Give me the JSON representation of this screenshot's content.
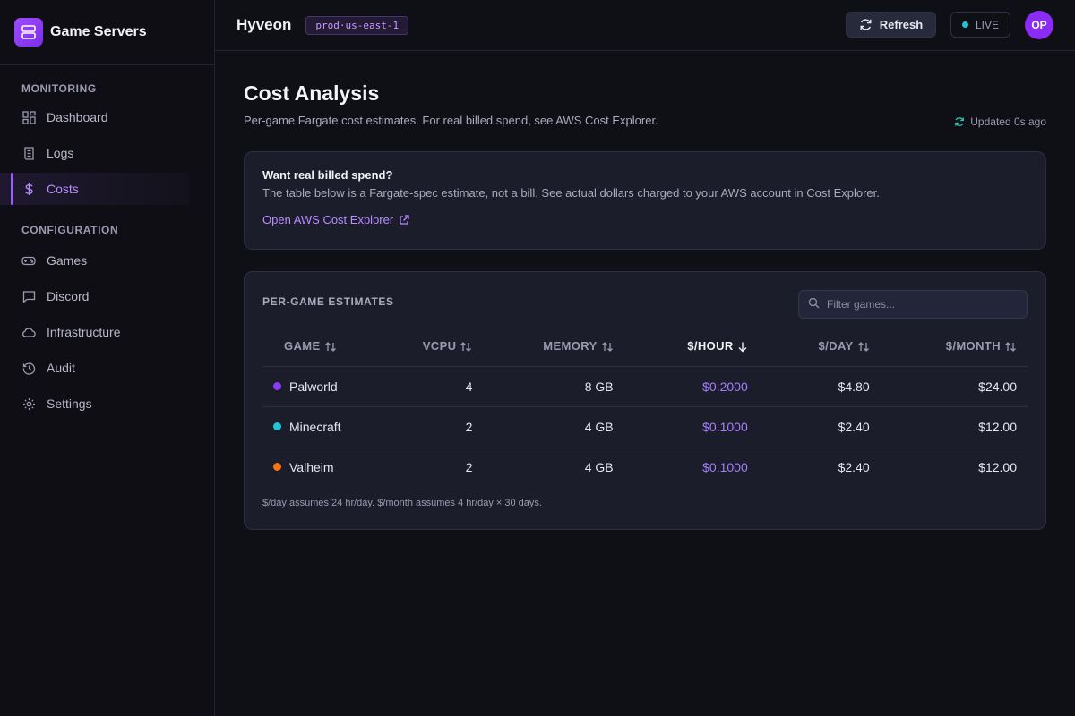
{
  "brand": {
    "title": "Game Servers"
  },
  "sidebar": {
    "sections": [
      {
        "title": "MONITORING",
        "items": [
          {
            "label": "Dashboard",
            "icon": "dashboard-icon"
          },
          {
            "label": "Logs",
            "icon": "logs-icon"
          },
          {
            "label": "Costs",
            "icon": "dollar-icon",
            "active": true
          }
        ]
      },
      {
        "title": "CONFIGURATION",
        "items": [
          {
            "label": "Games",
            "icon": "gamepad-icon"
          },
          {
            "label": "Discord",
            "icon": "chat-icon"
          },
          {
            "label": "Infrastructure",
            "icon": "cloud-icon"
          },
          {
            "label": "Audit",
            "icon": "history-icon"
          },
          {
            "label": "Settings",
            "icon": "gear-icon"
          }
        ]
      }
    ]
  },
  "topbar": {
    "app_name": "Hyveon",
    "env": "prod·us-east-1",
    "refresh_label": "Refresh",
    "live_label": "LIVE",
    "avatar_initials": "OP"
  },
  "page": {
    "title": "Cost Analysis",
    "subtitle": "Per-game Fargate cost estimates. For real billed spend, see AWS Cost Explorer.",
    "updated": "Updated 0s ago"
  },
  "callout": {
    "title": "Want real billed spend?",
    "body": "The table below is a Fargate-spec estimate, not a bill. See actual dollars charged to your AWS account in Cost Explorer.",
    "link": "Open AWS Cost Explorer"
  },
  "estimates": {
    "title": "PER-GAME ESTIMATES",
    "filter_placeholder": "Filter games...",
    "columns": [
      "GAME",
      "VCPU",
      "MEMORY",
      "$/HOUR",
      "$/DAY",
      "$/MONTH"
    ],
    "sorted_column": "$/HOUR",
    "rows": [
      {
        "game": "Palworld",
        "color": "#8b3cf5",
        "vcpu": "4",
        "memory": "8 GB",
        "hour": "$0.2000",
        "day": "$4.80",
        "month": "$24.00"
      },
      {
        "game": "Minecraft",
        "color": "#22c3d6",
        "vcpu": "2",
        "memory": "4 GB",
        "hour": "$0.1000",
        "day": "$2.40",
        "month": "$12.00"
      },
      {
        "game": "Valheim",
        "color": "#f97316",
        "vcpu": "2",
        "memory": "4 GB",
        "hour": "$0.1000",
        "day": "$2.40",
        "month": "$12.00"
      }
    ],
    "footnote": "$/day assumes 24 hr/day. $/month assumes 4 hr/day × 30 days."
  },
  "colors": {
    "accent": "#9d5cff",
    "background": "#0f1016",
    "card": "#1b1d2b"
  }
}
